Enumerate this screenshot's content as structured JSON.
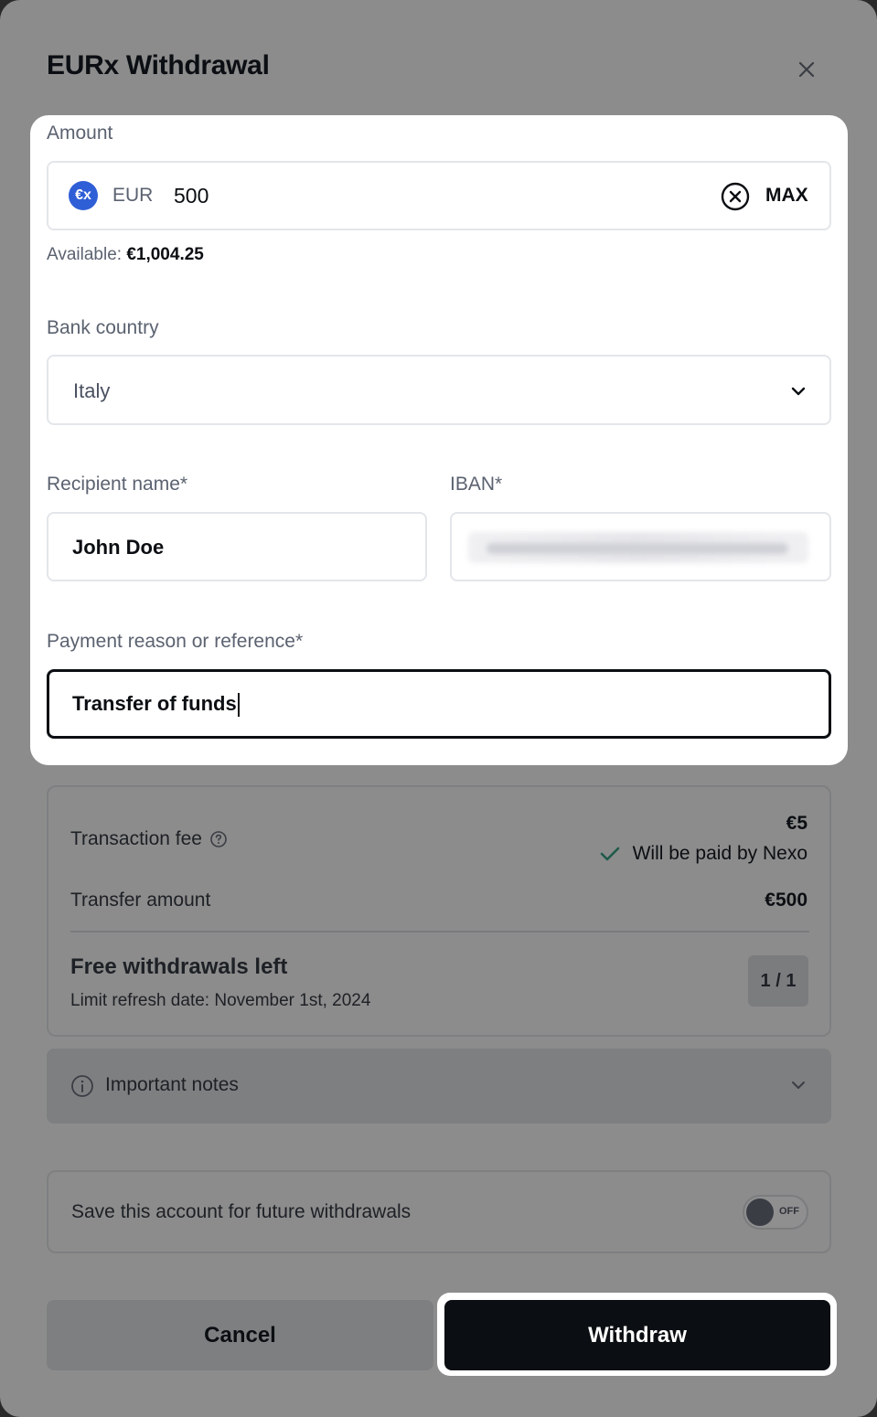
{
  "modal": {
    "title": "EURx Withdrawal"
  },
  "amount": {
    "label": "Amount",
    "coin_symbol": "€x",
    "currency": "EUR",
    "value": "500",
    "max_label": "MAX",
    "available_label": "Available:",
    "available_value": "€1,004.25"
  },
  "bank_country": {
    "label": "Bank country",
    "selected": "Italy"
  },
  "recipient": {
    "label": "Recipient name*",
    "value": "John Doe"
  },
  "iban": {
    "label": "IBAN*"
  },
  "reason": {
    "label": "Payment reason or reference*",
    "value": "Transfer of funds"
  },
  "fees": {
    "transaction_fee_label": "Transaction fee",
    "transaction_fee_value": "€5",
    "paid_by": "Will be paid by Nexo",
    "transfer_amount_label": "Transfer amount",
    "transfer_amount_value": "€500",
    "free_withdrawals_title": "Free withdrawals left",
    "refresh_date": "Limit refresh date: November 1st, 2024",
    "free_count": "1 / 1"
  },
  "notes": {
    "label": "Important notes"
  },
  "save_account": {
    "label": "Save this account for future withdrawals",
    "toggle_state": "OFF"
  },
  "actions": {
    "cancel": "Cancel",
    "withdraw": "Withdraw"
  },
  "colors": {
    "accent_dark": "#0b0e12",
    "coin_blue": "#2f5fd6",
    "check_green": "#1f5a4a",
    "overlay_gray": "#8c8c8c"
  }
}
